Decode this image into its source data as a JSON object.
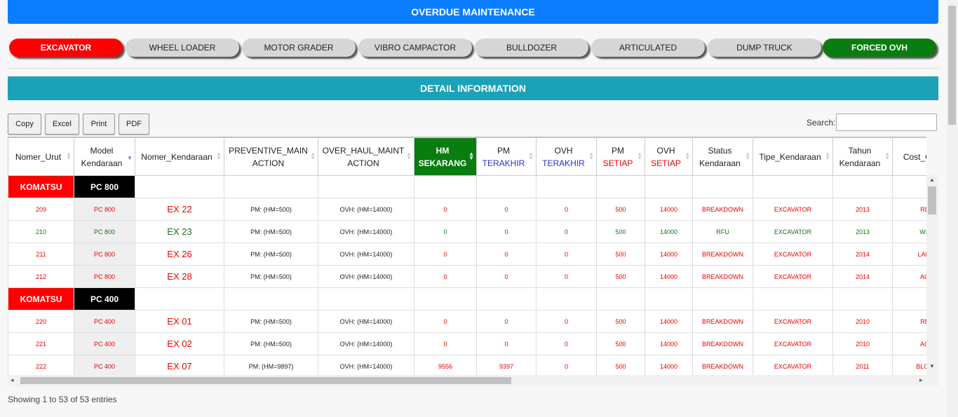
{
  "header": {
    "title": "OVERDUE MAINTENANCE"
  },
  "tabs": [
    {
      "label": "EXCAVATOR",
      "state": "active"
    },
    {
      "label": "WHEEL LOADER"
    },
    {
      "label": "MOTOR GRADER"
    },
    {
      "label": "VIBRO CAMPACTOR"
    },
    {
      "label": "BULLDOZER"
    },
    {
      "label": "ARTICULATED"
    },
    {
      "label": "DUMP TRUCK"
    },
    {
      "label": "FORCED OVH",
      "state": "highlight"
    }
  ],
  "detail": {
    "title": "DETAIL INFORMATION"
  },
  "toolbar": {
    "copy": "Copy",
    "excel": "Excel",
    "print": "Print",
    "pdf": "PDF"
  },
  "search": {
    "label": "Search:",
    "value": ""
  },
  "columns": [
    {
      "line1": "Nomer_Urut",
      "line2": ""
    },
    {
      "line1": "Model",
      "line2": "Kendaraan"
    },
    {
      "line1": "Nomer_Kendaraan",
      "line2": ""
    },
    {
      "line1": "PREVENTIVE_MAIN",
      "line2": "ACTION"
    },
    {
      "line1": "OVER_HAUL_MAINT",
      "line2": "ACTION"
    },
    {
      "line1": "HM",
      "line2": "SEKARANG"
    },
    {
      "line1": "PM",
      "line2": "TERAKHIR"
    },
    {
      "line1": "OVH",
      "line2": "TERAKHIR"
    },
    {
      "line1": "PM",
      "line2": "SETIAP"
    },
    {
      "line1": "OVH",
      "line2": "SETIAP"
    },
    {
      "line1": "Status",
      "line2": "Kendaraan"
    },
    {
      "line1": "Tipe_Kendaraan",
      "line2": ""
    },
    {
      "line1": "Tahun",
      "line2": "Kendaraan"
    },
    {
      "line1": "Cost_Cen",
      "line2": ""
    }
  ],
  "groups": [
    {
      "brand": "KOMATSU",
      "model": "PC 800",
      "rows": [
        [
          "209",
          "PC 800",
          "EX 22",
          "PM: (HM=500)",
          "OVH: (HM=14000)",
          "0",
          "0",
          "0",
          "500",
          "14000",
          "BREAKDOWN",
          "EXCAVATOR",
          "2013",
          "RE"
        ],
        [
          "210",
          "PC 800",
          "EX 23",
          "PM: (HM=500)",
          "OVH: (HM=14000)",
          "0",
          "0",
          "0",
          "500",
          "14000",
          "RFU",
          "EXCAVATOR",
          "2013",
          "WS"
        ],
        [
          "211",
          "PC 800",
          "EX 26",
          "PM: (HM=500)",
          "OVH: (HM=14000)",
          "0",
          "0",
          "0",
          "500",
          "14000",
          "BREAKDOWN",
          "EXCAVATOR",
          "2014",
          "LAIN"
        ],
        [
          "212",
          "PC 800",
          "EX 28",
          "PM: (HM=500)",
          "OVH: (HM=14000)",
          "0",
          "0",
          "0",
          "500",
          "14000",
          "BREAKDOWN",
          "EXCAVATOR",
          "2014",
          "AG"
        ]
      ],
      "row_status": [
        "r",
        "g",
        "r",
        "r"
      ]
    },
    {
      "brand": "KOMATSU",
      "model": "PC 400",
      "rows": [
        [
          "220",
          "PC 400",
          "EX 01",
          "PM: (HM=500)",
          "OVH: (HM=14000)",
          "0",
          "0",
          "0",
          "500",
          "14000",
          "BREAKDOWN",
          "EXCAVATOR",
          "2010",
          "RE"
        ],
        [
          "221",
          "PC 400",
          "EX 02",
          "PM: (HM=500)",
          "OVH: (HM=14000)",
          "0",
          "0",
          "0",
          "500",
          "14000",
          "BREAKDOWN",
          "EXCAVATOR",
          "2010",
          "AG"
        ],
        [
          "222",
          "PC 400",
          "EX 07",
          "PM: (HM=9897)",
          "OVH: (HM=14000)",
          "9556",
          "9397",
          "0",
          "500",
          "14000",
          "BREAKDOWN",
          "EXCAVATOR",
          "2011",
          "BLOC"
        ]
      ],
      "row_status": [
        "r",
        "r",
        "r"
      ]
    }
  ],
  "footer": {
    "info": "Showing 1 to 53 of 53 entries"
  },
  "colors": {
    "primary": "#0a7cff",
    "detail": "#1ba2b8",
    "active_tab": "#ff0000",
    "forced_tab": "#0a7d10",
    "breakdown": "#ee0000",
    "rfu": "#1b6e1b"
  }
}
